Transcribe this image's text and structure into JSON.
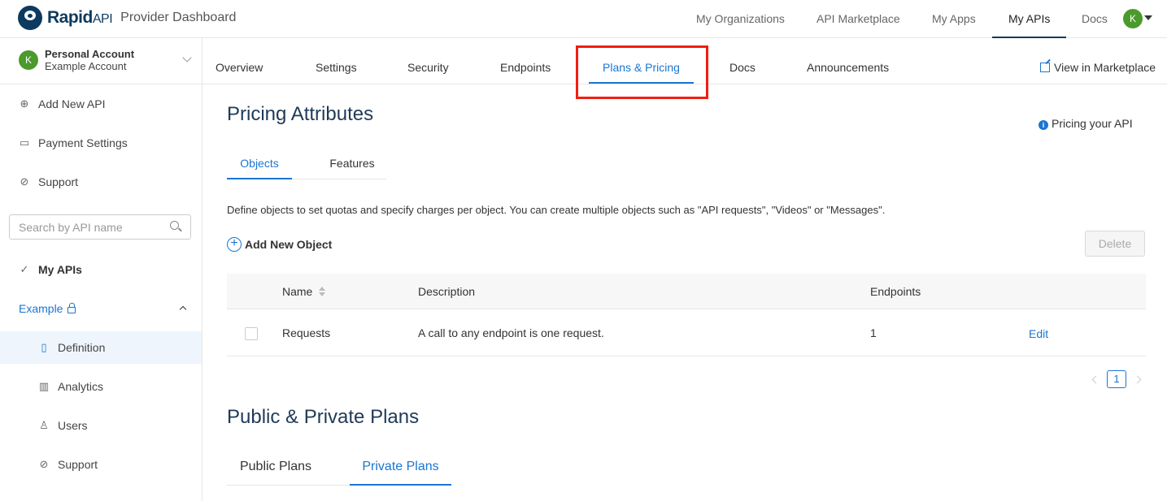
{
  "app": {
    "brand_main": "Rapid",
    "brand_api": "API",
    "subtitle": "Provider Dashboard"
  },
  "topnav": {
    "items": [
      "My Organizations",
      "API Marketplace",
      "My Apps",
      "My APIs",
      "Docs"
    ],
    "active": "My APIs",
    "avatar_letter": "K"
  },
  "sidebar": {
    "account_letter": "K",
    "account_name": "Personal Account",
    "account_sub": "Example Account",
    "add_api": "Add New API",
    "payment": "Payment Settings",
    "support": "Support",
    "search_placeholder": "Search by API name",
    "my_apis": "My APIs",
    "api_name": "Example",
    "sub_items": [
      "Definition",
      "Analytics",
      "Users",
      "Support"
    ],
    "selected_sub_item": "Definition"
  },
  "subnav": {
    "tabs": [
      "Overview",
      "Settings",
      "Security",
      "Endpoints",
      "Plans & Pricing",
      "Docs",
      "Announcements"
    ],
    "active": "Plans & Pricing",
    "view_marketplace": "View in Marketplace"
  },
  "pricing": {
    "title": "Pricing Attributes",
    "help_link": "Pricing your API",
    "tabs": [
      "Objects",
      "Features"
    ],
    "active_tab": "Objects",
    "description": "Define objects to set quotas and specify charges per object. You can create multiple objects such as \"API requests\", \"Videos\" or \"Messages\".",
    "add_object": "Add New Object",
    "delete": "Delete",
    "table": {
      "columns": [
        "Name",
        "Description",
        "Endpoints"
      ],
      "rows": [
        {
          "name": "Requests",
          "description": "A call to any endpoint is one request.",
          "endpoints": "1",
          "action": "Edit"
        }
      ]
    },
    "current_page": "1"
  },
  "plans": {
    "title": "Public & Private Plans",
    "tabs": [
      "Public Plans",
      "Private Plans"
    ],
    "active_tab": "Private Plans"
  },
  "colors": {
    "accent": "#1976d2",
    "brand": "#0d3a5e",
    "highlight": "#f01e12",
    "avatar": "#4a9a2c"
  }
}
